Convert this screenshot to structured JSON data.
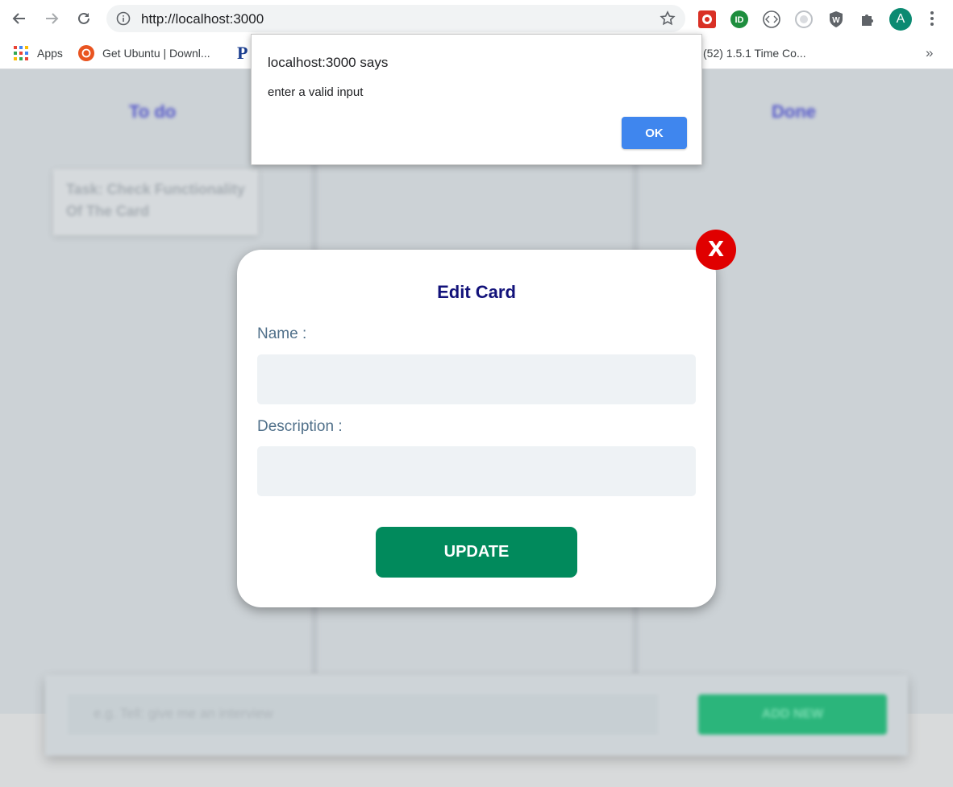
{
  "browser": {
    "url": "http://localhost:3000",
    "avatar_letter": "A",
    "bookmarks": [
      {
        "label": "Apps"
      },
      {
        "label": "Get Ubuntu | Downl..."
      },
      {
        "label": "P"
      },
      {
        "label": "(52) 1.5.1 Time Co..."
      }
    ],
    "more": "»"
  },
  "background": {
    "columns": [
      "To do",
      "Done"
    ],
    "card_text": "Task: Check Functionality Of The Card",
    "add_placeholder": "e.g. Tell: give me an interview",
    "add_button": "ADD NEW"
  },
  "modal": {
    "title": "Edit Card",
    "name_label": "Name :",
    "name_value": "",
    "description_label": "Description :",
    "description_value": "",
    "update_label": "UPDATE",
    "close_label": "X"
  },
  "alert": {
    "title": "localhost:3000 says",
    "message": "enter a valid input",
    "ok_label": "OK"
  },
  "colors": {
    "accent_green": "#018a5c",
    "close_red": "#e00000",
    "ok_blue": "#3f86ee",
    "title_navy": "#12127a"
  }
}
